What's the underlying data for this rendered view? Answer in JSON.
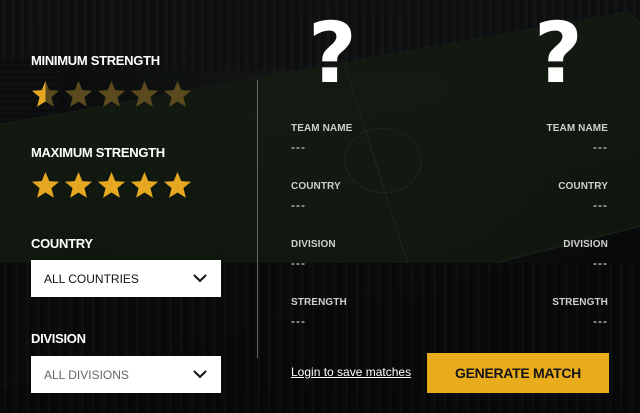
{
  "filters": {
    "min_strength": {
      "label": "MINIMUM STRENGTH",
      "rating": 0.5,
      "max": 5
    },
    "max_strength": {
      "label": "MAXIMUM STRENGTH",
      "rating": 5,
      "max": 5
    },
    "country": {
      "label": "COUNTRY",
      "selected": "ALL COUNTRIES"
    },
    "division": {
      "label": "DIVISION",
      "selected": "ALL DIVISIONS"
    }
  },
  "teams": [
    {
      "placeholder": "?",
      "fields": [
        {
          "label": "TEAM NAME",
          "value": "---"
        },
        {
          "label": "COUNTRY",
          "value": "---"
        },
        {
          "label": "DIVISION",
          "value": "---"
        },
        {
          "label": "STRENGTH",
          "value": "---"
        }
      ]
    },
    {
      "placeholder": "?",
      "fields": [
        {
          "label": "TEAM NAME",
          "value": "---"
        },
        {
          "label": "COUNTRY",
          "value": "---"
        },
        {
          "label": "DIVISION",
          "value": "---"
        },
        {
          "label": "STRENGTH",
          "value": "---"
        }
      ]
    }
  ],
  "actions": {
    "login_link": "Login to save matches",
    "generate_button": "GENERATE MATCH"
  },
  "colors": {
    "accent": "#e8ac1c",
    "star_fill": "#e5a820",
    "star_empty": "#5a4a1e"
  }
}
